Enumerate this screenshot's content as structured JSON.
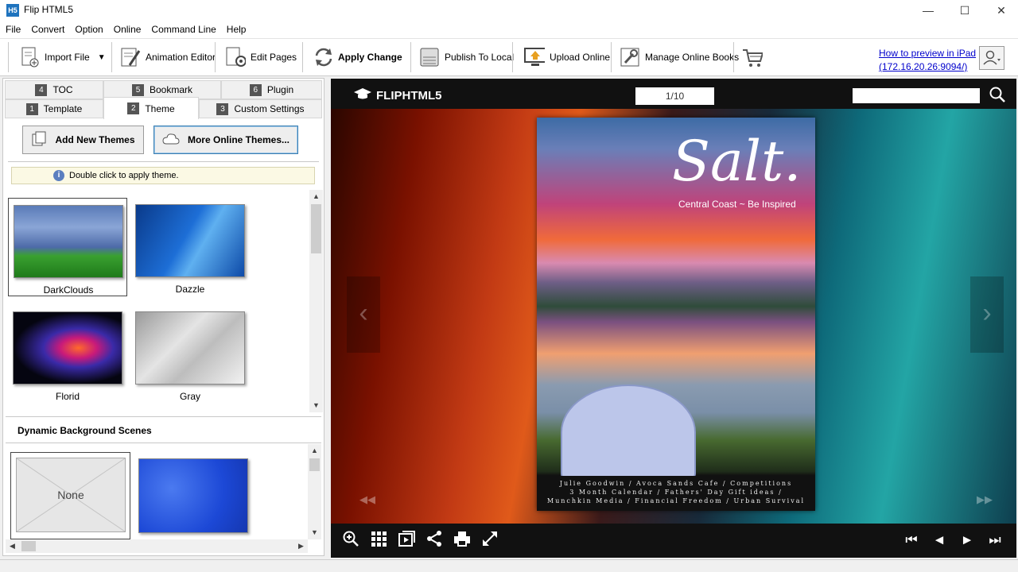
{
  "window": {
    "title": "Flip HTML5",
    "app_icon": "H5"
  },
  "menu": [
    "File",
    "Convert",
    "Option",
    "Online",
    "Command Line",
    "Help"
  ],
  "toolbar": {
    "import_file": "Import File",
    "animation_editor": "Animation Editor",
    "edit_pages": "Edit Pages",
    "apply_change": "Apply Change",
    "publish_to_local": "Publish To Local",
    "upload_online": "Upload Online",
    "manage_online_books": "Manage Online Books",
    "help_link_line1": "How to preview in iPad",
    "help_link_line2": "(172.16.20.26:9094/)"
  },
  "tabs": {
    "row1": [
      {
        "num": "4",
        "label": "TOC"
      },
      {
        "num": "5",
        "label": "Bookmark"
      },
      {
        "num": "6",
        "label": "Plugin"
      }
    ],
    "row2": [
      {
        "num": "1",
        "label": "Template"
      },
      {
        "num": "2",
        "label": "Theme"
      },
      {
        "num": "3",
        "label": "Custom Settings"
      }
    ]
  },
  "theme_panel": {
    "add_new_themes": "Add New Themes",
    "more_online_themes": "More Online Themes...",
    "hint": "Double click to apply theme.",
    "themes": [
      {
        "label": "DarkClouds",
        "selected": true
      },
      {
        "label": "Dazzle",
        "selected": false
      },
      {
        "label": "Florid",
        "selected": false
      },
      {
        "label": "Gray",
        "selected": false
      }
    ]
  },
  "dynamic_panel": {
    "title": "Dynamic Background Scenes",
    "none_label": "None"
  },
  "viewer": {
    "brand": "FLIPHTML5",
    "page_indicator": "1/10",
    "book": {
      "title": "Salt.",
      "subtitle": "Central Coast ~ Be Inspired",
      "footer_line1": "Julie  Goodwin  /  Avoca  Sands  Cafe  /  Competitions",
      "footer_line2": "3  Month  Calendar  /  Fathers'  Day  Gift  ideas  /",
      "footer_line3": "Munchkin  Media  /  Financial  Freedom  /  Urban  Survival"
    }
  },
  "colors": {
    "link": "#0000cc",
    "viewer_bar": "#111111",
    "accent_blue": "#1e73be"
  }
}
